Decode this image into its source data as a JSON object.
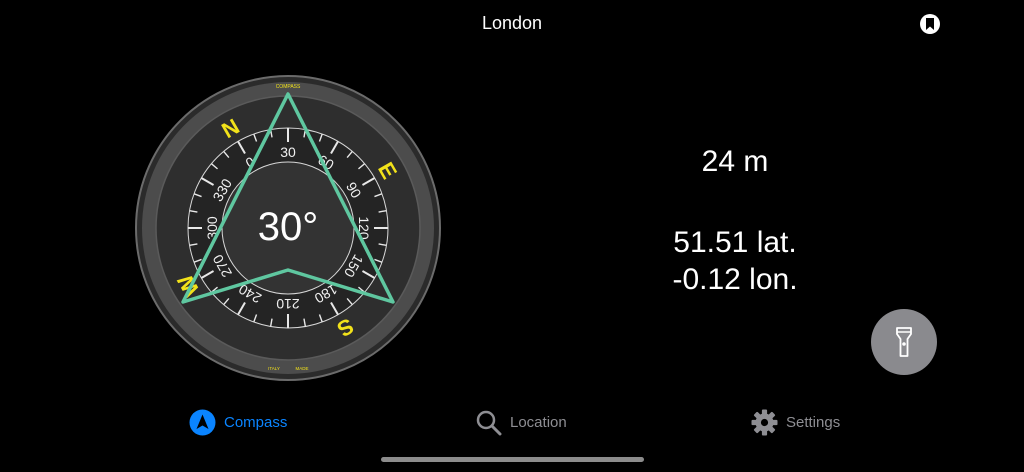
{
  "header": {
    "title": "London"
  },
  "compass": {
    "heading_text": "30°",
    "heading_degrees": 30,
    "cardinals": [
      "N",
      "E",
      "S",
      "W"
    ],
    "bezel_labels": [
      "0",
      "30",
      "60",
      "90",
      "120",
      "150",
      "180",
      "210",
      "240",
      "270",
      "300",
      "330"
    ],
    "brand_top": "COMPASS",
    "brand_bottom_left": "ITALY",
    "brand_bottom_right": "MADE",
    "colors": {
      "cardinal": "#f2e21a",
      "needle": "#5fc7a0",
      "bezel": "#4a4a4a"
    }
  },
  "info": {
    "altitude": "24 m",
    "latitude": "51.51 lat.",
    "longitude": "-0.12 lon."
  },
  "tabs": [
    {
      "label": "Compass",
      "icon": "compass-icon",
      "active": true
    },
    {
      "label": "Location",
      "icon": "magnifier-icon",
      "active": false
    },
    {
      "label": "Settings",
      "icon": "gear-icon",
      "active": false
    }
  ],
  "colors": {
    "accent": "#0a84ff",
    "inactive": "#8e8e93",
    "flash_button": "#8a8a8e"
  }
}
